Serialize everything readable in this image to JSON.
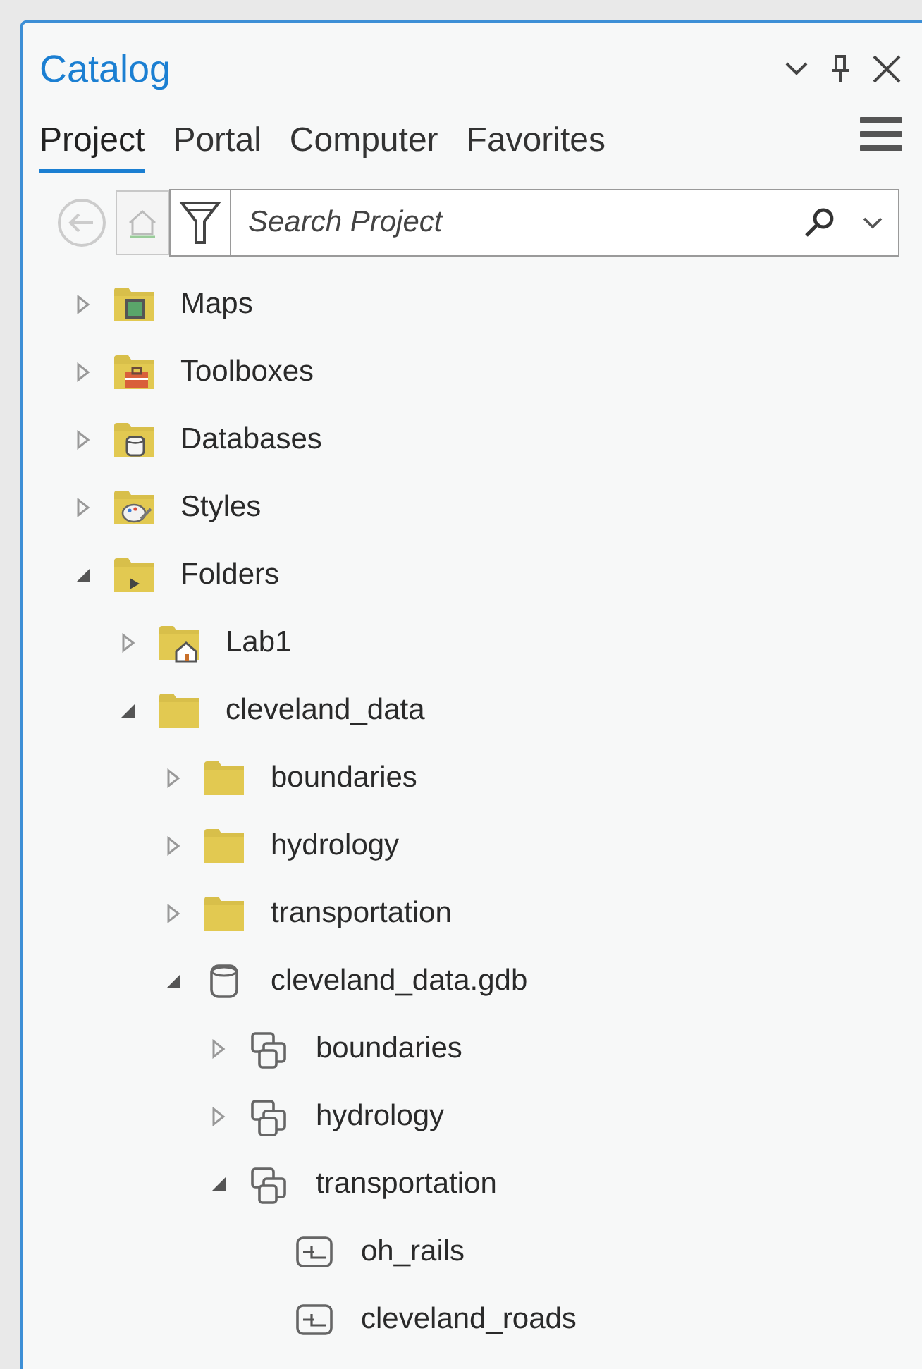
{
  "panel": {
    "title": "Catalog"
  },
  "tabs": [
    {
      "label": "Project",
      "selected": true
    },
    {
      "label": "Portal",
      "selected": false
    },
    {
      "label": "Computer",
      "selected": false
    },
    {
      "label": "Favorites",
      "selected": false
    }
  ],
  "search": {
    "placeholder": "Search Project"
  },
  "tree": [
    {
      "label": "Maps",
      "kind": "maps",
      "expanded": false
    },
    {
      "label": "Toolboxes",
      "kind": "toolboxes",
      "expanded": false
    },
    {
      "label": "Databases",
      "kind": "databases",
      "expanded": false
    },
    {
      "label": "Styles",
      "kind": "styles",
      "expanded": false
    },
    {
      "label": "Folders",
      "kind": "folders",
      "expanded": true,
      "children": [
        {
          "label": "Lab1",
          "kind": "home",
          "expanded": false
        },
        {
          "label": "cleveland_data",
          "kind": "folder",
          "expanded": true,
          "children": [
            {
              "label": "boundaries",
              "kind": "folder",
              "expanded": false
            },
            {
              "label": "hydrology",
              "kind": "folder",
              "expanded": false
            },
            {
              "label": "transportation",
              "kind": "folder",
              "expanded": false
            },
            {
              "label": "cleveland_data.gdb",
              "kind": "gdb",
              "expanded": true,
              "children": [
                {
                  "label": "boundaries",
                  "kind": "dataset",
                  "expanded": false
                },
                {
                  "label": "hydrology",
                  "kind": "dataset",
                  "expanded": false
                },
                {
                  "label": "transportation",
                  "kind": "dataset",
                  "expanded": true,
                  "children": [
                    {
                      "label": "oh_rails",
                      "kind": "featureclass"
                    },
                    {
                      "label": "cleveland_roads",
                      "kind": "featureclass"
                    }
                  ]
                }
              ]
            }
          ]
        }
      ]
    }
  ]
}
